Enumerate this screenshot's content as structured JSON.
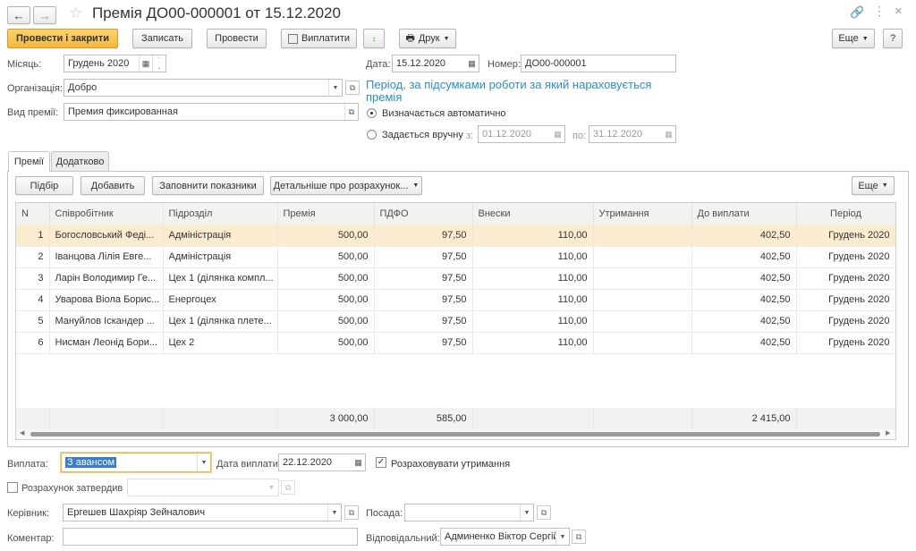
{
  "title": "Премія ДО00-000001 от 15.12.2020",
  "toolbar": {
    "post_close": "Провести і закрити",
    "save": "Записать",
    "post": "Провести",
    "pay": "Виплатити",
    "print": "Друк",
    "more": "Еще",
    "help": "?"
  },
  "form": {
    "month_label": "Місяць:",
    "month_value": "Грудень 2020",
    "date_label": "Дата:",
    "date_value": "15.12.2020",
    "number_label": "Номер:",
    "number_value": "ДО00-000001",
    "org_label": "Організація:",
    "org_value": "Добро",
    "bonus_type_label": "Вид премії:",
    "bonus_type_value": "Премия фиксированная",
    "period_heading": "Період, за підсумками роботи за який нараховується премія",
    "radio_auto": "Визначається автоматично",
    "radio_manual": "Задається вручну",
    "from_label": "з:",
    "from_value": "01.12.2020",
    "to_label": "по:",
    "to_value": "31.12.2020"
  },
  "tabs": [
    "Премії",
    "Додатково"
  ],
  "table_toolbar": {
    "pick": "Підбір",
    "add": "Добавить",
    "fill": "Заповнити показники",
    "details": "Детальніше про розрахунок...",
    "more": "Еще"
  },
  "table": {
    "columns": [
      "N",
      "Співробітник",
      "Підрозділ",
      "Премія",
      "ПДФО",
      "Внески",
      "Утримання",
      "До виплати",
      "Період"
    ],
    "rows": [
      [
        "1",
        "Богословський Феді...",
        "Адміністрація",
        "500,00",
        "97,50",
        "110,00",
        "",
        "402,50",
        "Грудень 2020"
      ],
      [
        "2",
        "Іванцова Лілія Евге...",
        "Адміністрація",
        "500,00",
        "97,50",
        "110,00",
        "",
        "402,50",
        "Грудень 2020"
      ],
      [
        "3",
        "Ларін Володимир Ге...",
        "Цех 1 (ділянка компл...",
        "500,00",
        "97,50",
        "110,00",
        "",
        "402,50",
        "Грудень 2020"
      ],
      [
        "4",
        "Уварова Віола Борис...",
        "Енергоцех",
        "500,00",
        "97,50",
        "110,00",
        "",
        "402,50",
        "Грудень 2020"
      ],
      [
        "5",
        "Мануйлов Іскандер ...",
        "Цех 1 (ділянка плете...",
        "500,00",
        "97,50",
        "110,00",
        "",
        "402,50",
        "Грудень 2020"
      ],
      [
        "6",
        "Нисман Леонід Бори...",
        "Цех 2",
        "500,00",
        "97,50",
        "110,00",
        "",
        "402,50",
        "Грудень 2020"
      ]
    ],
    "totals": [
      "",
      "",
      "",
      "3 000,00",
      "585,00",
      "",
      "",
      "2 415,00",
      ""
    ]
  },
  "bottom": {
    "payment_label": "Виплата:",
    "payment_value": "З авансом",
    "pay_date_label": "Дата виплати:",
    "pay_date_value": "22.12.2020",
    "calc_deductions": "Розраховувати утримання",
    "calc_approved": "Розрахунок затвердив",
    "head_label": "Керівник:",
    "head_value": "Ергешев Шахріяр Зейналович",
    "position_label": "Посада:",
    "comment_label": "Коментар:",
    "responsible_label": "Відповідальний:",
    "responsible_value": "Админенко Віктор Сергійо"
  },
  "colors": {
    "accent_blue": "#2a8fc9",
    "primary_button": "#f5bf47",
    "selected_row": "#fbeccf"
  }
}
